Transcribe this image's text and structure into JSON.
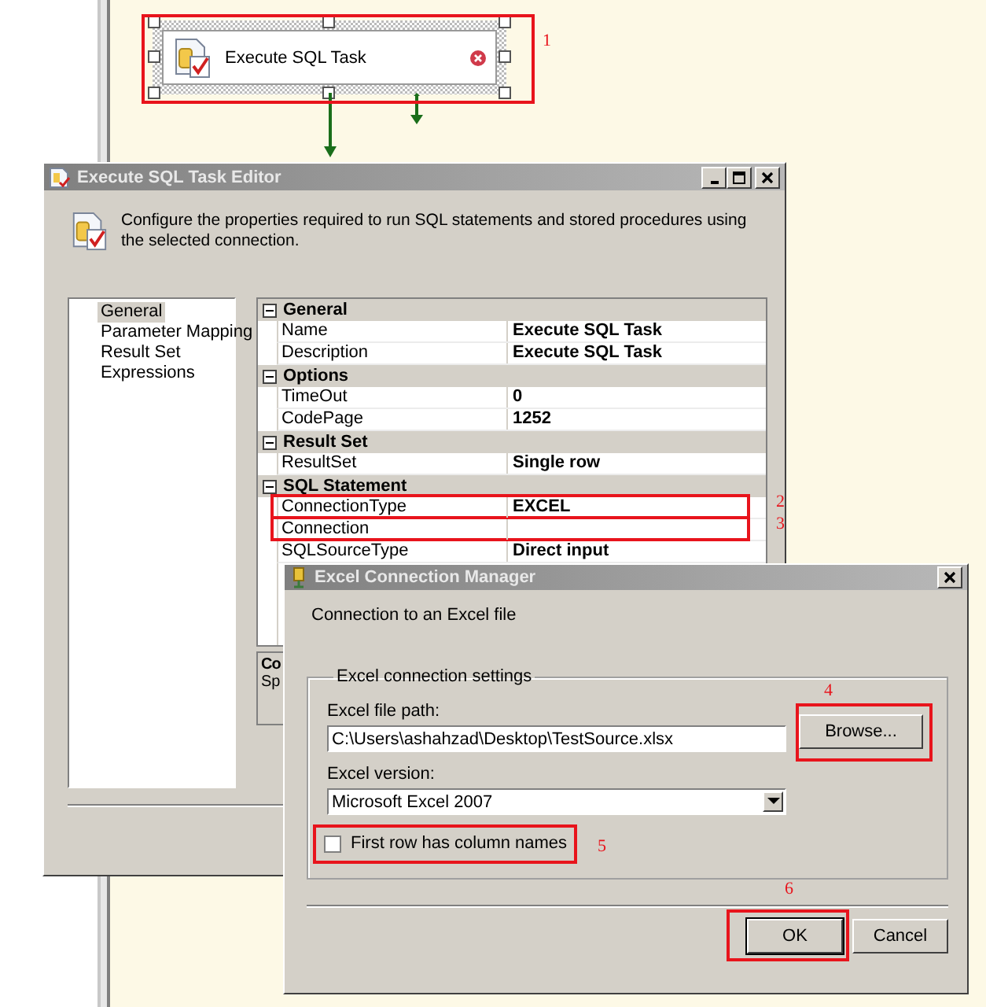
{
  "canvas": {
    "task": {
      "label": "Execute SQL Task",
      "selected": true,
      "error": true,
      "annotation": "1"
    }
  },
  "editor": {
    "title": "Execute SQL Task Editor",
    "description": "Configure the properties required to run SQL statements and stored procedures using the selected connection.",
    "pages": [
      {
        "label": "General",
        "selected": true
      },
      {
        "label": "Parameter Mapping",
        "selected": false
      },
      {
        "label": "Result Set",
        "selected": false
      },
      {
        "label": "Expressions",
        "selected": false
      }
    ],
    "properties": [
      {
        "kind": "category",
        "label": "General",
        "expanded": true
      },
      {
        "kind": "property",
        "name": "Name",
        "value": "Execute SQL Task"
      },
      {
        "kind": "property",
        "name": "Description",
        "value": "Execute SQL Task"
      },
      {
        "kind": "category",
        "label": "Options",
        "expanded": true
      },
      {
        "kind": "property",
        "name": "TimeOut",
        "value": "0"
      },
      {
        "kind": "property",
        "name": "CodePage",
        "value": "1252"
      },
      {
        "kind": "category",
        "label": "Result Set",
        "expanded": true
      },
      {
        "kind": "property",
        "name": "ResultSet",
        "value": "Single row"
      },
      {
        "kind": "category",
        "label": "SQL Statement",
        "expanded": true
      },
      {
        "kind": "property",
        "name": "ConnectionType",
        "value": "EXCEL",
        "annotation": "2"
      },
      {
        "kind": "property",
        "name": "Connection",
        "annotation": "3"
      },
      {
        "kind": "property",
        "name": "SQLSourceType",
        "value": "Direct input"
      }
    ],
    "help": {
      "title": "Co",
      "text": "Sp"
    }
  },
  "excel_dialog": {
    "title": "Excel Connection Manager",
    "description": "Connection to an Excel file",
    "group_title": "Excel connection settings",
    "file_path": {
      "label": "Excel file path:",
      "value": "C:\\Users\\ashahzad\\Desktop\\TestSource.xlsx"
    },
    "browse_button": {
      "label": "Browse...",
      "annotation": "4"
    },
    "version": {
      "label": "Excel version:",
      "value": "Microsoft Excel 2007"
    },
    "first_row_checkbox": {
      "label": "First row has column names",
      "checked": false,
      "annotation": "5"
    },
    "buttons": [
      {
        "label": "OK",
        "kind": "default",
        "annotation": "6"
      },
      {
        "label": "Cancel",
        "kind": "normal"
      }
    ]
  }
}
